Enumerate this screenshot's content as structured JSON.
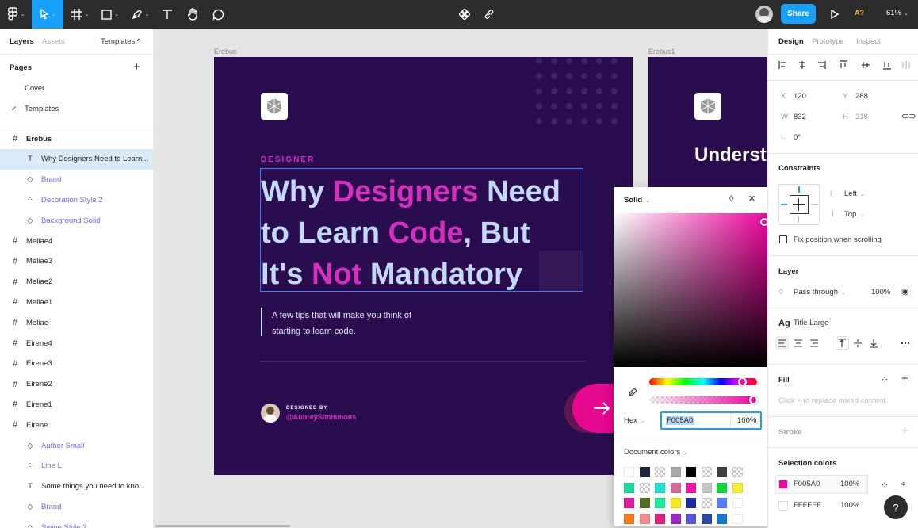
{
  "toolbar": {
    "share_label": "Share",
    "zoom": "61%",
    "badge": "A?"
  },
  "left_panel": {
    "tabs": [
      "Layers",
      "Assets"
    ],
    "templates_label": "Templates ^",
    "pages_title": "Pages",
    "pages": [
      "Cover",
      "Templates"
    ],
    "layers": [
      {
        "icon": "frame",
        "label": "Erebus",
        "bold": true
      },
      {
        "icon": "text",
        "label": "Why Designers Need to Learn...",
        "selected": true
      },
      {
        "icon": "instance",
        "label": "Brand"
      },
      {
        "icon": "component",
        "label": "Decoration Style 2"
      },
      {
        "icon": "instance",
        "label": "Background Solid"
      },
      {
        "icon": "frame",
        "label": "Meliae4"
      },
      {
        "icon": "frame",
        "label": "Meliae3"
      },
      {
        "icon": "frame",
        "label": "Meliae2"
      },
      {
        "icon": "frame",
        "label": "Meliae1"
      },
      {
        "icon": "frame",
        "label": "Meliae"
      },
      {
        "icon": "frame",
        "label": "Eirene4"
      },
      {
        "icon": "frame",
        "label": "Eirene3"
      },
      {
        "icon": "frame",
        "label": "Eirene2"
      },
      {
        "icon": "frame",
        "label": "Eirene1"
      },
      {
        "icon": "frame",
        "label": "Eirene"
      },
      {
        "icon": "instance",
        "label": "Author Small"
      },
      {
        "icon": "component",
        "label": "Line L"
      },
      {
        "icon": "text",
        "label": "Some things you need to kno..."
      },
      {
        "icon": "instance",
        "label": "Brand"
      },
      {
        "icon": "component",
        "label": "Swipe Style 2"
      }
    ]
  },
  "canvas": {
    "frame1_label": "Erebus",
    "frame2_label": "Erebus1",
    "eyebrow": "DESIGNER",
    "headline_parts": {
      "l1a": "Why ",
      "l1b": "Designers",
      "l1c": " Need",
      "l2a": "to Learn ",
      "l2b": "Code",
      "l2c": ", But",
      "l3a": "It's ",
      "l3b": "Not",
      "l3c": " Mandatory"
    },
    "subtitle_1": "A few tips that will make you think of",
    "subtitle_2": "starting to learn code.",
    "designed_by": "DESIGNED BY",
    "author": "@AubreySimmmons",
    "frame2_headline": "Underst",
    "colors": {
      "bg": "#2a0d4f",
      "accent": "#d42fbf",
      "text": "#c5d9ff",
      "pink": "#f005a0"
    }
  },
  "picker": {
    "fill_type": "Solid",
    "hex_label": "Hex",
    "hex_value": "F005A0",
    "opacity": "100%",
    "doc_colors_label": "Document colors",
    "swatches": [
      [
        "#ffffff",
        "#1e2740",
        "checker",
        "#a8a8a8",
        "#000000",
        "checker",
        "#404040",
        "checker"
      ],
      [
        "#1fd8a0",
        "checker",
        "#24e0d0",
        "#d56b9c",
        "#ef11a8",
        "#c4c4c4",
        "#10d83a",
        "#f2ec3c"
      ],
      [
        "#dc1d9c",
        "#4f7023",
        "#1fe89e",
        "#f8e81e",
        "#1b2ca3",
        "checker",
        "#5a7cff",
        "#ffffff"
      ],
      [
        "#f57c1d",
        "#f78b8b",
        "#d9257a",
        "#9b2ac8",
        "#5757d9",
        "#2b4aa4",
        "#1679c9",
        "#ffffff"
      ]
    ]
  },
  "right_panel": {
    "tabs": [
      "Design",
      "Prototype",
      "Inspect"
    ],
    "x": "120",
    "y": "288",
    "w": "832",
    "h": "318",
    "rotation": "0°",
    "constraints_title": "Constraints",
    "constraint_h": "Left",
    "constraint_v": "Top",
    "fix_position": "Fix position when scrolling",
    "layer_title": "Layer",
    "blend": "Pass through",
    "layer_opacity": "100%",
    "text_style": "Title Large",
    "fill_title": "Fill",
    "fill_hint": "Click + to replace mixed content.",
    "stroke_title": "Stroke",
    "selection_colors_title": "Selection colors",
    "selection_colors": [
      {
        "hex": "F005A0",
        "opacity": "100%",
        "color": "#f005a0"
      },
      {
        "hex": "FFFFFF",
        "opacity": "100%",
        "color": "#ffffff"
      }
    ]
  }
}
